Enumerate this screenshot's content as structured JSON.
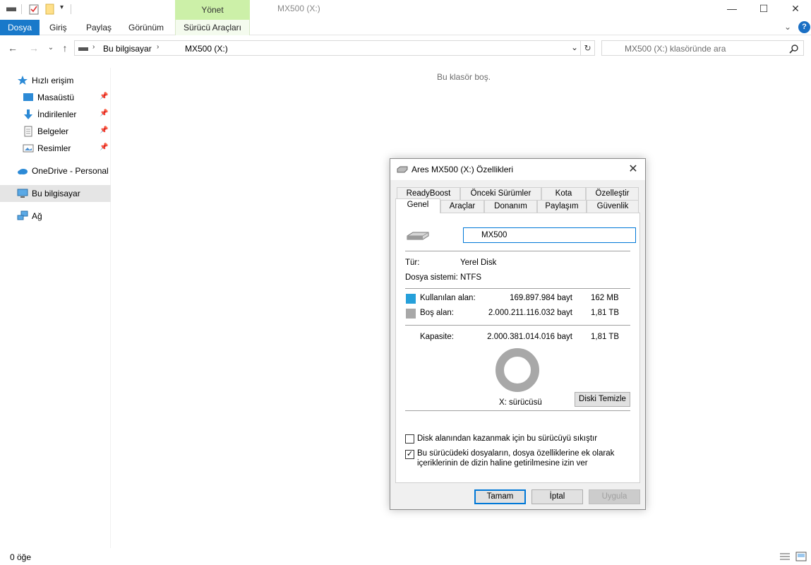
{
  "titlebar": {
    "window_title": "MX500 (X:)",
    "manage_tab": "Yönet",
    "minimize_glyph": "—",
    "maximize_glyph": "☐",
    "close_glyph": "✕"
  },
  "ribbon": {
    "tabs": [
      "Dosya",
      "Giriş",
      "Paylaş",
      "Görünüm"
    ],
    "drive_tools_tab": "Sürücü Araçları",
    "help_glyph": "?"
  },
  "address": {
    "crumbs": [
      "Bu bilgisayar",
      "MX500 (X:)"
    ],
    "search_placeholder": "MX500 (X:) klasöründe ara"
  },
  "nav": {
    "quick_access": "Hızlı erişim",
    "items": [
      "Masaüstü",
      "İndirilenler",
      "Belgeler",
      "Resimler"
    ],
    "onedrive": "OneDrive - Personal",
    "this_pc": "Bu bilgisayar",
    "network": "Ağ"
  },
  "content": {
    "empty_message": "Bu klasör boş."
  },
  "status": {
    "item_count": "0 öğe"
  },
  "dialog": {
    "title": "Ares MX500 (X:) Özellikleri",
    "tabs_row1": [
      "ReadyBoost",
      "Önceki Sürümler",
      "Kota",
      "Özelleştir"
    ],
    "tabs_row2": [
      "Genel",
      "Araçlar",
      "Donanım",
      "Paylaşım",
      "Güvenlik"
    ],
    "name_value": "MX500",
    "type_label": "Tür:",
    "type_value": "Yerel Disk",
    "fs_label": "Dosya sistemi:",
    "fs_value": "NTFS",
    "used_label": "Kullanılan alan:",
    "used_bytes": "169.897.984 bayt",
    "used_human": "162 MB",
    "free_label": "Boş alan:",
    "free_bytes": "2.000.211.116.032 bayt",
    "free_human": "1,81 TB",
    "capacity_label": "Kapasite:",
    "capacity_bytes": "2.000.381.014.016 bayt",
    "capacity_human": "1,81 TB",
    "drive_label": "X: sürücüsü",
    "cleanup_button": "Diski Temizle",
    "compress_label": "Disk alanından kazanmak için bu sürücüyü sıkıştır",
    "index_label_line1": "Bu sürücüdeki dosyaların, dosya özelliklerine ek olarak",
    "index_label_line2": "içeriklerinin de dizin haline getirilmesine izin ver",
    "compress_checked": false,
    "index_checked": true,
    "ok_button": "Tamam",
    "cancel_button": "İptal",
    "apply_button": "Uygula",
    "used_color": "#26a0da",
    "free_color": "#a8a8a8"
  }
}
